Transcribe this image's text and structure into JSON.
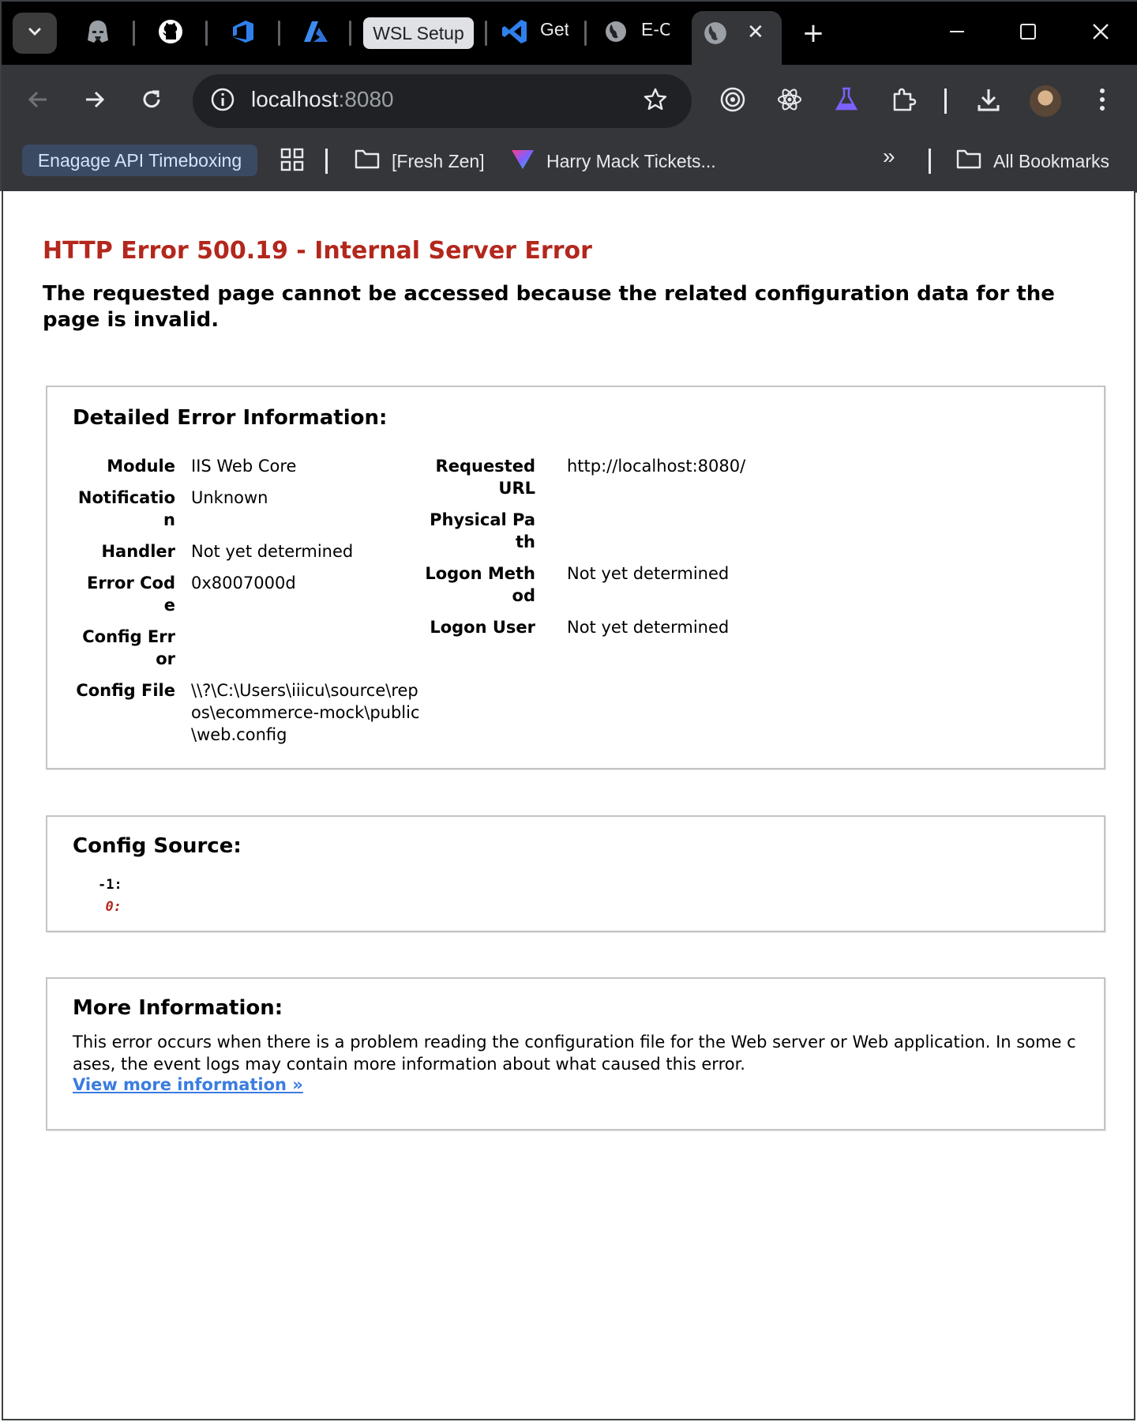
{
  "browser": {
    "tabs": [
      {
        "name": "darth-vader-tab",
        "icon": "darth-vader-icon"
      },
      {
        "name": "github-tab",
        "icon": "github-icon"
      },
      {
        "name": "azure-devops-tab",
        "icon": "azure-devops-icon"
      },
      {
        "name": "azure-tab",
        "icon": "azure-icon"
      }
    ],
    "tab_group_label": "WSL Setup",
    "vscode_tab_title": "Get",
    "ecommerce_tab_title": "E-C",
    "active_tab_close": "✕",
    "new_tab": "+",
    "url_host": "localhost",
    "url_port": ":8080",
    "bookmarks": {
      "chip_label": "Enagage API Timeboxing",
      "folder_fresh_zen": "[Fresh Zen]",
      "harry_mack": "Harry Mack Tickets...",
      "overflow": "»",
      "all_bookmarks": "All Bookmarks"
    },
    "colors": {
      "tabstrip_bg": "#000000",
      "toolbar_bg": "#35363a",
      "bookmark_chip_bg": "#3b4a63",
      "vscode_blue": "#2f80ed",
      "lab_purple": "#7b61ff"
    }
  },
  "page": {
    "title": "HTTP Error 500.19 - Internal Server Error",
    "subtitle": "The requested page cannot be accessed because the related configuration data for the page is invalid.",
    "title_color": "#b3271c",
    "details": {
      "heading": "Detailed Error Information:",
      "left": [
        {
          "label": "Module",
          "value": "IIS Web Core"
        },
        {
          "label": "Notification",
          "value": "Unknown"
        },
        {
          "label": "Handler",
          "value": "Not yet determined"
        },
        {
          "label": "Error Code",
          "value": "0x8007000d"
        },
        {
          "label": "Config Error",
          "value": ""
        },
        {
          "label": "Config File",
          "value": "\\\\?\\C:\\Users\\iiicu\\source\\repos\\ecommerce-mock\\public\\web.config"
        }
      ],
      "right": [
        {
          "label": "Requested URL",
          "value": "http://localhost:8080/"
        },
        {
          "label": "Physical Path",
          "value": ""
        },
        {
          "label": "Logon Method",
          "value": "Not yet determined"
        },
        {
          "label": "Logon User",
          "value": "Not yet determined"
        }
      ]
    },
    "config_source": {
      "heading": "Config Source:",
      "lines": [
        {
          "number": "-1:",
          "highlight": false
        },
        {
          "number": "0:",
          "highlight": true
        }
      ]
    },
    "more_info": {
      "heading": "More Information:",
      "text": "This error occurs when there is a problem reading the configuration file for the Web server or Web application. In some cases, the event logs may contain more information about what caused this error.",
      "link": "View more information »",
      "link_color": "#3b7ce0"
    }
  }
}
